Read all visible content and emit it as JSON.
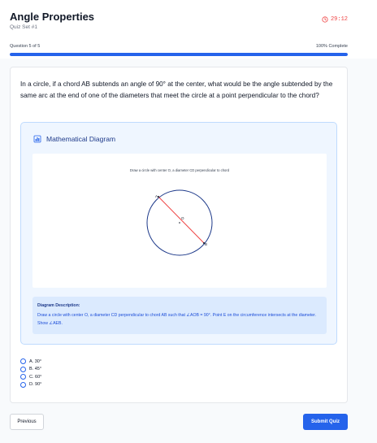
{
  "header": {
    "title": "Angle Properties",
    "subtitle": "Quiz Set #1",
    "timer": "29:12",
    "question_counter": "Question 5 of 5",
    "completion_text": "100% Complete",
    "progress": 1.0
  },
  "question": {
    "text": "In a circle, if a chord AB subtends an angle of 90° at the center, what would be the angle subtended by the same arc at the end of one of the diameters that meet the circle at a point perpendicular to the chord?"
  },
  "diagram": {
    "heading": "Mathematical Diagram",
    "icon": "bar-chart-icon",
    "caption": "Draw a circle with center O, a diameter CD perpendicular to chord",
    "labels": {
      "a": "A",
      "o": "O",
      "b": "B"
    },
    "description_title": "Diagram Description:",
    "description_text": "Draw a circle with center O, a diameter CD perpendicular to chord AB such that ∠AOB = 90°. Point E on the circumference intersects at the diameter. Show ∠AEB."
  },
  "options": [
    {
      "label": "A. 30°"
    },
    {
      "label": "B. 45°"
    },
    {
      "label": "C. 60°"
    },
    {
      "label": "D. 90°"
    }
  ],
  "buttons": {
    "previous": "Previous",
    "submit": "Submit Quiz"
  },
  "colors": {
    "accent": "#2563eb",
    "timer": "#ef4444",
    "chord": "#ef4444"
  }
}
